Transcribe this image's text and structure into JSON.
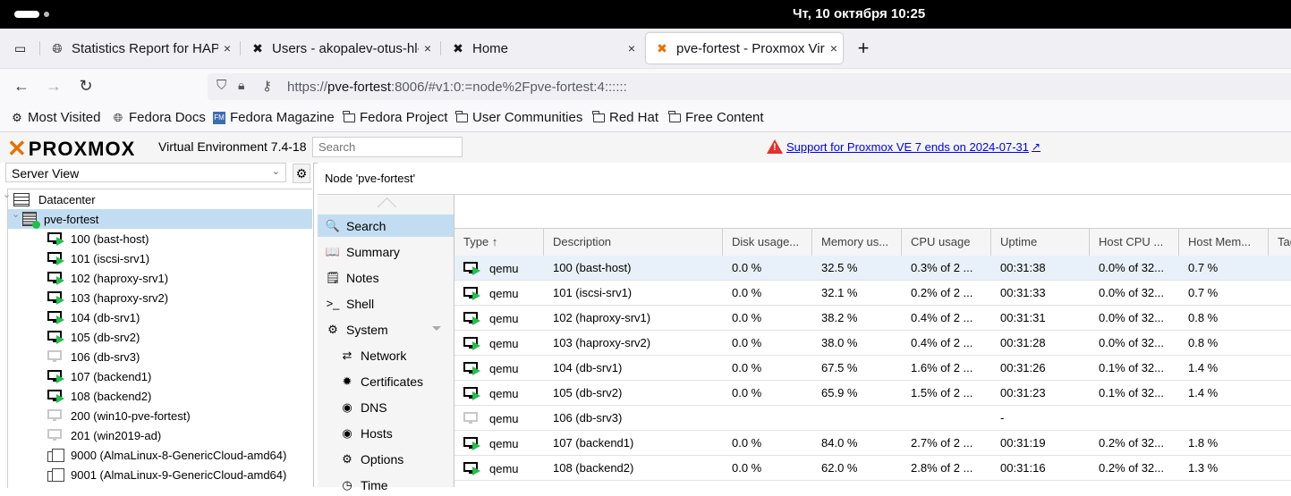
{
  "gnome": {
    "clock": "Чт, 10 октября  10:25"
  },
  "browser": {
    "tabs": [
      {
        "label": "Statistics Report for HAProxy",
        "icon": "globe-icon",
        "close": "×"
      },
      {
        "label": "Users - akopalev-otus-hl-u",
        "icon": "favicon-icon",
        "close": "×"
      },
      {
        "label": "Home",
        "icon": "favicon-icon",
        "close": "×"
      },
      {
        "label": "pve-fortest - Proxmox Virtual",
        "icon": "proxmox-favicon-icon",
        "close": "×"
      }
    ],
    "new_tab": "+",
    "url_prefix": "https://",
    "url_host": "pve-fortest",
    "url_rest": ":8006/#v1:0:=node%2Fpve-fortest:4::::::",
    "bookmarks": [
      {
        "label": "Most Visited",
        "icon": "gear-icon"
      },
      {
        "label": "Fedora Docs",
        "icon": "globe-icon"
      },
      {
        "label": "Fedora Magazine",
        "icon": "fedora-magazine-icon"
      },
      {
        "label": "Fedora Project",
        "icon": "folder-icon"
      },
      {
        "label": "User Communities",
        "icon": "folder-icon"
      },
      {
        "label": "Red Hat",
        "icon": "folder-icon"
      },
      {
        "label": "Free Content",
        "icon": "folder-icon"
      }
    ]
  },
  "pve": {
    "logo": "PROXMOX",
    "version": "Virtual Environment 7.4-18",
    "search_placeholder": "Search",
    "support_notice": "Support for Proxmox VE 7 ends on 2024-07-31",
    "server_view": "Server View",
    "tree": [
      {
        "label": "Datacenter",
        "kind": "datacenter"
      },
      {
        "label": "pve-fortest",
        "kind": "node"
      },
      {
        "label": "100 (bast-host)",
        "kind": "vm-running"
      },
      {
        "label": "101 (iscsi-srv1)",
        "kind": "vm-running"
      },
      {
        "label": "102 (haproxy-srv1)",
        "kind": "vm-running"
      },
      {
        "label": "103 (haproxy-srv2)",
        "kind": "vm-running"
      },
      {
        "label": "104 (db-srv1)",
        "kind": "vm-running"
      },
      {
        "label": "105 (db-srv2)",
        "kind": "vm-running"
      },
      {
        "label": "106 (db-srv3)",
        "kind": "vm-stopped"
      },
      {
        "label": "107 (backend1)",
        "kind": "vm-running"
      },
      {
        "label": "108 (backend2)",
        "kind": "vm-running"
      },
      {
        "label": "200 (win10-pve-fortest)",
        "kind": "vm-stopped"
      },
      {
        "label": "201 (win2019-ad)",
        "kind": "vm-stopped"
      },
      {
        "label": "9000 (AlmaLinux-8-GenericCloud-amd64)",
        "kind": "template"
      },
      {
        "label": "9001 (AlmaLinux-9-GenericCloud-amd64)",
        "kind": "template"
      }
    ],
    "panel_title": "Node 'pve-fortest'",
    "menu": [
      {
        "label": "Search",
        "icon": "search-icon",
        "glyph": "🔍"
      },
      {
        "label": "Summary",
        "icon": "book-icon",
        "glyph": "📖"
      },
      {
        "label": "Notes",
        "icon": "notes-icon",
        "glyph": "🗒"
      },
      {
        "label": "Shell",
        "icon": "terminal-icon",
        "glyph": ">_"
      },
      {
        "label": "System",
        "icon": "cogs-icon",
        "glyph": "⚙"
      },
      {
        "label": "Network",
        "icon": "exchange-icon",
        "glyph": "⇄"
      },
      {
        "label": "Certificates",
        "icon": "certificate-icon",
        "glyph": "✹"
      },
      {
        "label": "DNS",
        "icon": "globe-icon",
        "glyph": "◉"
      },
      {
        "label": "Hosts",
        "icon": "globe-icon",
        "glyph": "◉"
      },
      {
        "label": "Options",
        "icon": "gear-icon",
        "glyph": "⚙"
      },
      {
        "label": "Time",
        "icon": "clock-icon",
        "glyph": "◷"
      }
    ],
    "columns": [
      "Type ↑",
      "Description",
      "Disk usage...",
      "Memory us...",
      "CPU usage",
      "Uptime",
      "Host CPU ...",
      "Host Mem...",
      "Tags"
    ],
    "rows": [
      {
        "type": "qemu",
        "running": true,
        "desc": "100 (bast-host)",
        "disk": "0.0 %",
        "mem": "32.5 %",
        "cpu": "0.3% of 2 ...",
        "uptime": "00:31:38",
        "hcpu": "0.0% of 32...",
        "hmem": "0.7 %"
      },
      {
        "type": "qemu",
        "running": true,
        "desc": "101 (iscsi-srv1)",
        "disk": "0.0 %",
        "mem": "32.1 %",
        "cpu": "0.2% of 2 ...",
        "uptime": "00:31:33",
        "hcpu": "0.0% of 32...",
        "hmem": "0.7 %"
      },
      {
        "type": "qemu",
        "running": true,
        "desc": "102 (haproxy-srv1)",
        "disk": "0.0 %",
        "mem": "38.2 %",
        "cpu": "0.4% of 2 ...",
        "uptime": "00:31:31",
        "hcpu": "0.0% of 32...",
        "hmem": "0.8 %"
      },
      {
        "type": "qemu",
        "running": true,
        "desc": "103 (haproxy-srv2)",
        "disk": "0.0 %",
        "mem": "38.0 %",
        "cpu": "0.4% of 2 ...",
        "uptime": "00:31:28",
        "hcpu": "0.0% of 32...",
        "hmem": "0.8 %"
      },
      {
        "type": "qemu",
        "running": true,
        "desc": "104 (db-srv1)",
        "disk": "0.0 %",
        "mem": "67.5 %",
        "cpu": "1.6% of 2 ...",
        "uptime": "00:31:26",
        "hcpu": "0.1% of 32...",
        "hmem": "1.4 %"
      },
      {
        "type": "qemu",
        "running": true,
        "desc": "105 (db-srv2)",
        "disk": "0.0 %",
        "mem": "65.9 %",
        "cpu": "1.5% of 2 ...",
        "uptime": "00:31:23",
        "hcpu": "0.1% of 32...",
        "hmem": "1.4 %"
      },
      {
        "type": "qemu",
        "running": false,
        "desc": "106 (db-srv3)",
        "disk": "",
        "mem": "",
        "cpu": "",
        "uptime": "-",
        "hcpu": "",
        "hmem": ""
      },
      {
        "type": "qemu",
        "running": true,
        "desc": "107 (backend1)",
        "disk": "0.0 %",
        "mem": "84.0 %",
        "cpu": "2.7% of 2 ...",
        "uptime": "00:31:19",
        "hcpu": "0.2% of 32...",
        "hmem": "1.8 %"
      },
      {
        "type": "qemu",
        "running": true,
        "desc": "108 (backend2)",
        "disk": "0.0 %",
        "mem": "62.0 %",
        "cpu": "2.8% of 2 ...",
        "uptime": "00:31:16",
        "hcpu": "0.2% of 32...",
        "hmem": "1.3 %"
      }
    ]
  }
}
